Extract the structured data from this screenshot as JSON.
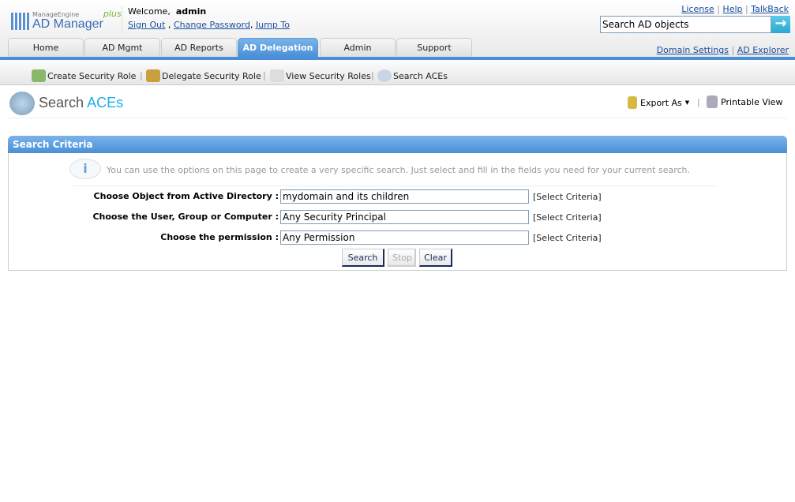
{
  "logo": {
    "brand": "ManageEngine",
    "product": "AD Manager",
    "suffix": "plus"
  },
  "user": {
    "welcome": "Welcome,",
    "name": "admin",
    "sign_out": "Sign Out",
    "change_password": "Change Password",
    "jump_to": "Jump To"
  },
  "toplinks": {
    "license": "License",
    "help": "Help",
    "talkback": "TalkBack"
  },
  "search": {
    "placeholder": "Search AD objects"
  },
  "tabs": [
    "Home",
    "AD Mgmt",
    "AD Reports",
    "AD Delegation",
    "Admin",
    "Support"
  ],
  "right_links": {
    "domain_settings": "Domain Settings",
    "ad_explorer": "AD Explorer"
  },
  "subnav": [
    "Create Security Role",
    "Delegate Security Role",
    "View Security Roles",
    "Search ACEs"
  ],
  "page": {
    "title_a": "Search",
    "title_b": "ACEs",
    "export": "Export As",
    "printable": "Printable View"
  },
  "panel": {
    "title": "Search Criteria",
    "info": "You can use the options on this page to create a very specific search. Just select and fill in the fields you need for your current search.",
    "fields": [
      {
        "label": "Choose Object from Active Directory :",
        "value": "mydomain and its children",
        "link": "[Select Criteria]"
      },
      {
        "label": "Choose the User, Group or Computer :",
        "value": "Any Security Principal",
        "link": "[Select Criteria]"
      },
      {
        "label": "Choose the permission :",
        "value": "Any Permission",
        "link": "[Select Criteria]"
      }
    ],
    "buttons": {
      "search": "Search",
      "stop": "Stop",
      "clear": "Clear"
    }
  }
}
